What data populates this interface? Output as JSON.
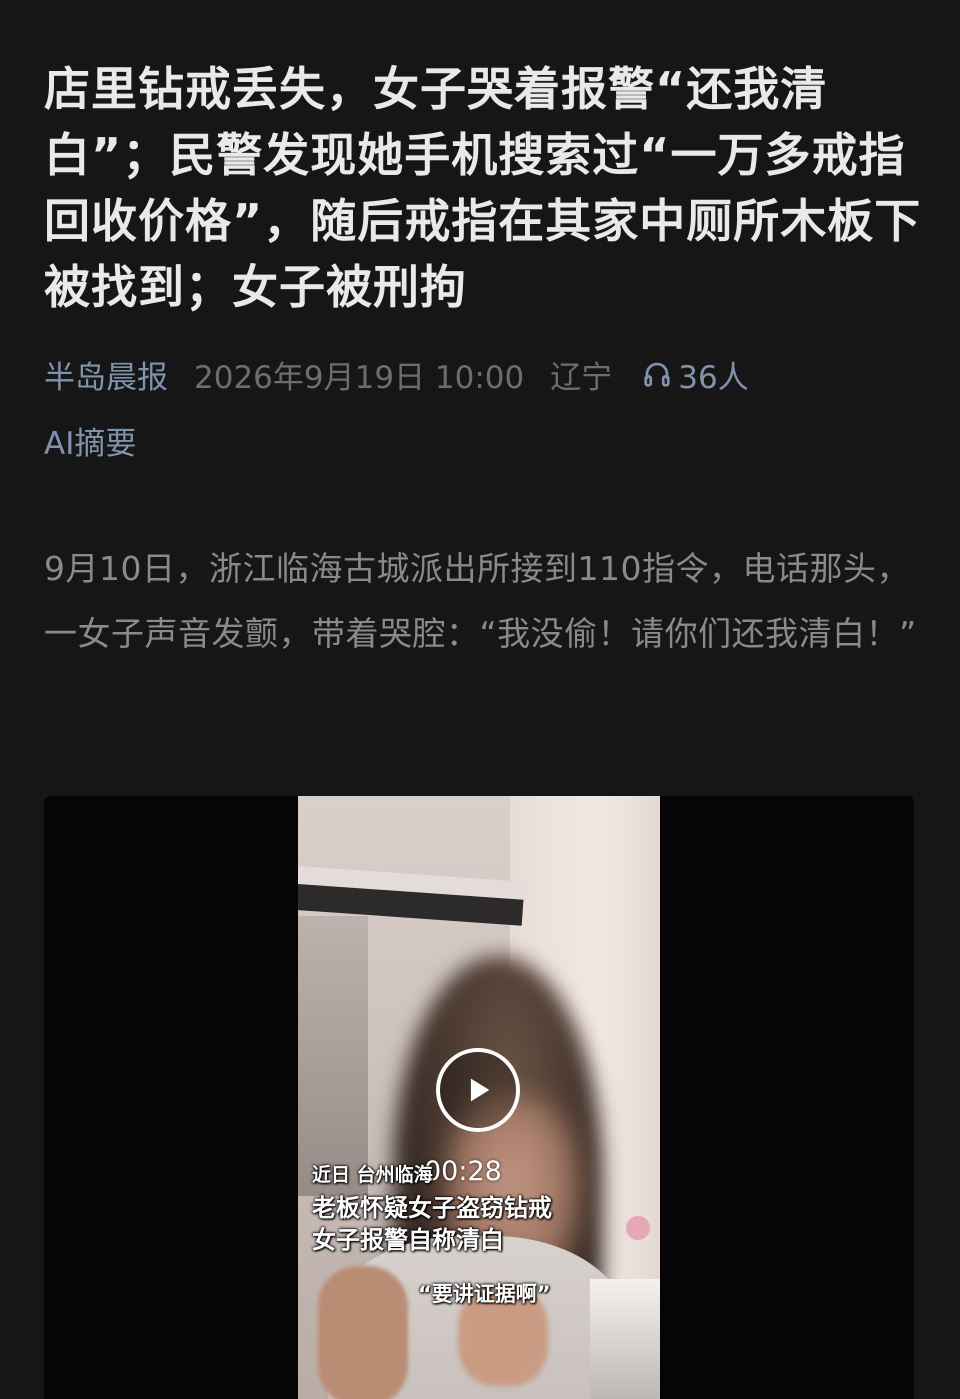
{
  "article": {
    "headline": "店里钻戒丢失，女子哭着报警“还我清白”；民警发现她手机搜索过“一万多戒指回收价格”，随后戒指在其家中厕所木板下被找到；女子被刑拘",
    "meta": {
      "source": "半岛晨报",
      "date": "2026年9月19日 10:00",
      "region": "辽宁",
      "listen_count": "36人",
      "listen_icon": "headphones-icon"
    },
    "ai_summary_label": "AI摘要",
    "body": "9月10日，浙江临海古城派出所接到110指令，电话那头，一女子声音发颤，带着哭腔：“我没偷！请你们还我清白！”"
  },
  "video": {
    "play_icon": "play-icon",
    "duration": "00:28",
    "captions": {
      "line1": "近日 台州临海",
      "line2": "老板怀疑女子盗窃钻戒",
      "line3": "女子报警自称清白",
      "quote": "“要讲证据啊”"
    }
  },
  "colors": {
    "background": "#161616",
    "headline": "#e9e9e9",
    "accent_link": "#7f93ad",
    "muted": "#6d6d6d",
    "body_text": "#8a8a8a"
  }
}
